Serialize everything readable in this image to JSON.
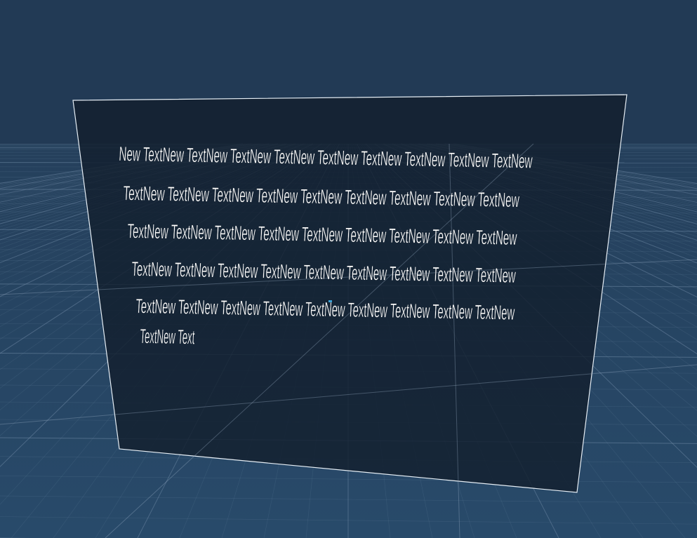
{
  "scene": {
    "background_color": "#223a55",
    "ground_grid_color": "#6f8aa6",
    "panel_fill": "#121f2d",
    "panel_border": "#e6eef5",
    "text_color": "#ffffff"
  },
  "text_panel": {
    "lines": [
      "New TextNew TextNew TextNew TextNew TextNew TextNew TextNew TextNew TextNew",
      "TextNew TextNew TextNew TextNew TextNew TextNew TextNew TextNew TextNew",
      "TextNew TextNew TextNew TextNew TextNew TextNew TextNew TextNew TextNew",
      "TextNew TextNew TextNew TextNew TextNew TextNew TextNew TextNew TextNew",
      "TextNew TextNew TextNew TextNew TextNew TextNew TextNew TextNew TextNew",
      "TextNew Text"
    ]
  }
}
